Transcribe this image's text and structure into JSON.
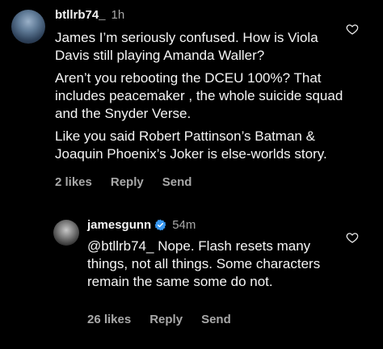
{
  "comments": [
    {
      "username": "btllrb74_",
      "time": "1h",
      "paragraphs": [
        "James I’m seriously confused.  How is Viola Davis still playing Amanda Waller?",
        "Aren’t you rebooting the DCEU 100%? That includes peacemaker , the whole suicide squad and the Snyder Verse.",
        "Like you said Robert Pattinson’s Batman & Joaquin Phoenix’s Joker is else-worlds story."
      ],
      "likes": "2 likes",
      "reply": "Reply",
      "send": "Send"
    },
    {
      "username": "jamesgunn",
      "verified": true,
      "time": "54m",
      "paragraphs": [
        "@btllrb74_ Nope. Flash resets many things, not all things. Some characters remain the same some do not."
      ],
      "likes": "26 likes",
      "reply": "Reply",
      "send": "Send"
    }
  ],
  "colors": {
    "background": "#000000",
    "text": "#f5f5f5",
    "secondary": "#a8a8a8",
    "verified": "#3897f0"
  },
  "icons": {
    "like": "heart-outline-icon",
    "verified": "verified-badge-icon"
  }
}
